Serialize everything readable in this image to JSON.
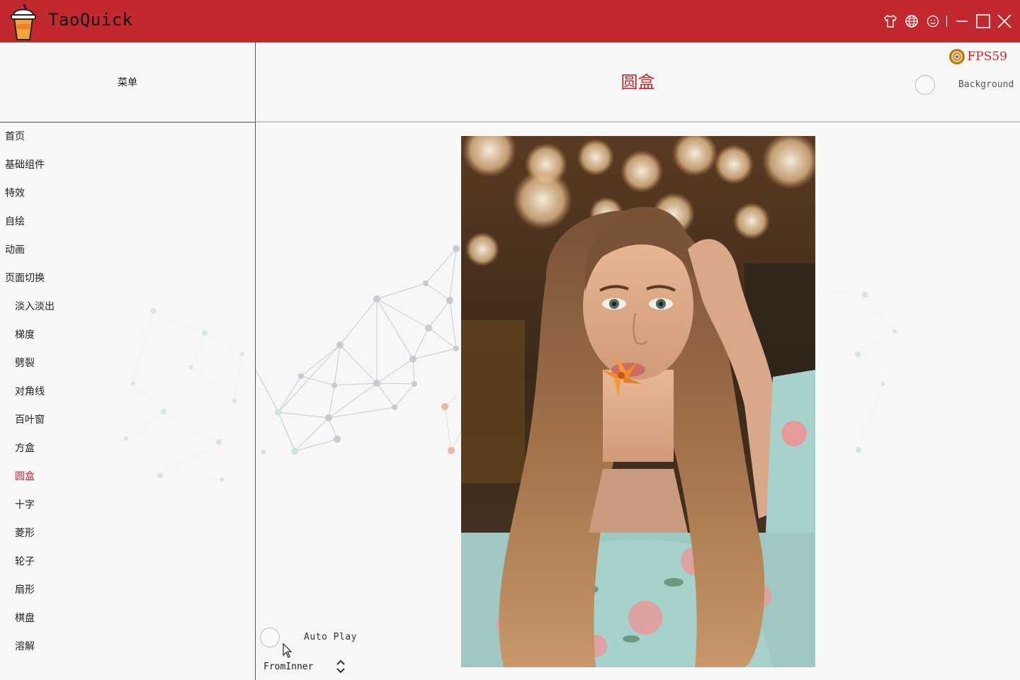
{
  "app": {
    "title": "TaoQuick",
    "logo_icon": "milk-tea-cup-icon"
  },
  "window_controls": {
    "icons": [
      "tshirt-icon",
      "globe-icon",
      "smiley-icon",
      "minimize-icon",
      "maximize-icon",
      "close-icon"
    ]
  },
  "sidebar": {
    "header": "菜单",
    "items": [
      {
        "label": "首页",
        "level": 0,
        "active": false
      },
      {
        "label": "基础组件",
        "level": 0,
        "active": false
      },
      {
        "label": "特效",
        "level": 0,
        "active": false
      },
      {
        "label": "自绘",
        "level": 0,
        "active": false
      },
      {
        "label": "动画",
        "level": 0,
        "active": false
      },
      {
        "label": "页面切换",
        "level": 0,
        "active": false
      },
      {
        "label": "淡入淡出",
        "level": 1,
        "active": false
      },
      {
        "label": "梯度",
        "level": 1,
        "active": false
      },
      {
        "label": "劈裂",
        "level": 1,
        "active": false
      },
      {
        "label": "对角线",
        "level": 1,
        "active": false
      },
      {
        "label": "百叶窗",
        "level": 1,
        "active": false
      },
      {
        "label": "方盒",
        "level": 1,
        "active": false
      },
      {
        "label": "圆盒",
        "level": 1,
        "active": true
      },
      {
        "label": "十字",
        "level": 1,
        "active": false
      },
      {
        "label": "菱形",
        "level": 1,
        "active": false
      },
      {
        "label": "轮子",
        "level": 1,
        "active": false
      },
      {
        "label": "扇形",
        "level": 1,
        "active": false
      },
      {
        "label": "棋盘",
        "level": 1,
        "active": false
      },
      {
        "label": "溶解",
        "level": 1,
        "active": false
      }
    ]
  },
  "main": {
    "title": "圆盒",
    "fps_label": "FPS59",
    "background_label": "Background",
    "autoplay_label": "Auto Play",
    "mode_value": "FromInner"
  },
  "colors": {
    "accent": "#c1292e",
    "network_lines": "#c8cad2",
    "network_faint": "#bfe0dc",
    "network_red": "#e8a294"
  }
}
